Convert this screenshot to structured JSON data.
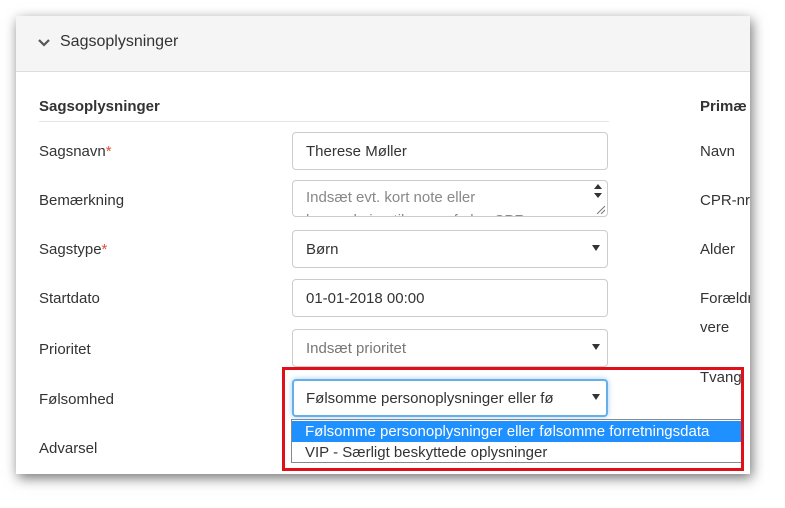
{
  "panel": {
    "title": "Sagsoplysninger"
  },
  "section": {
    "title": "Sagsoplysninger",
    "right_title": "Primæ"
  },
  "colors": {
    "required": "#e74c3c",
    "focus": "#66afe9",
    "selected_option": "#1e90ff",
    "callout": "#e0101a"
  },
  "fields": {
    "sagsnavn": {
      "label": "Sagsnavn",
      "required_mark": "*",
      "value": "Therese Møller"
    },
    "bemaerkning": {
      "label": "Bemærkning",
      "placeholder_line1": "Indsæt evt. kort note eller",
      "placeholder_line2": "hemærkning til sagen f.eks. CPR"
    },
    "sagstype": {
      "label": "Sagstype",
      "required_mark": "*",
      "value": "Børn"
    },
    "startdato": {
      "label": "Startdato",
      "value": "01-01-2018 00:00"
    },
    "prioritet": {
      "label": "Prioritet",
      "placeholder": "Indsæt prioritet"
    },
    "folsomhed": {
      "label": "Følsomhed",
      "value": "Følsomme personoplysninger eller fø"
    },
    "advarsel": {
      "label": "Advarsel"
    }
  },
  "dropdown": {
    "options": [
      {
        "label": "Følsomme personoplysninger eller følsomme forretningsdata",
        "selected": true
      },
      {
        "label": "VIP - Særligt beskyttede oplysninger",
        "selected": false
      }
    ]
  },
  "right_column": {
    "labels": [
      "Navn",
      "CPR-nr",
      "Alder",
      "Forældr",
      "vere",
      "Tvang"
    ]
  }
}
